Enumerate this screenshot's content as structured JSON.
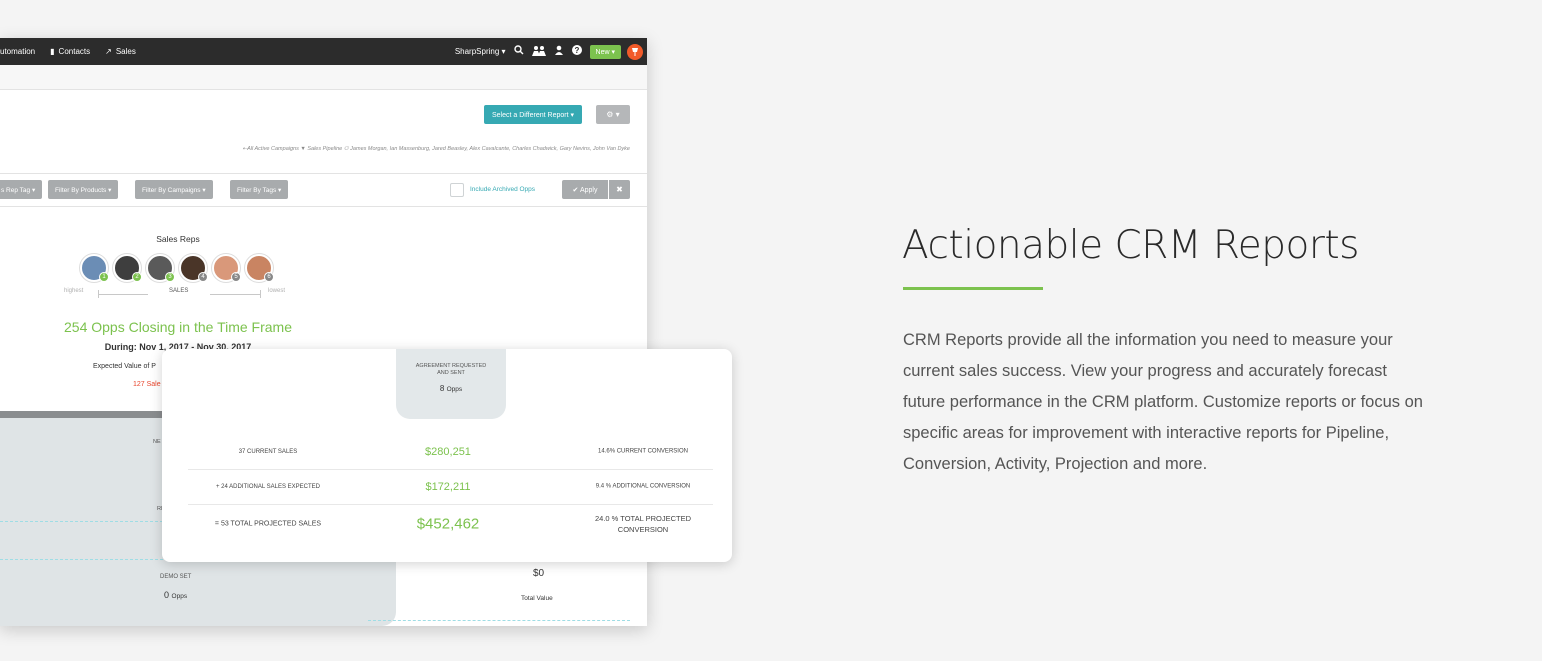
{
  "topbar": {
    "nav": [
      {
        "icon": "automation-icon",
        "glyph": "",
        "label": "utomation"
      },
      {
        "icon": "contacts-icon",
        "glyph": "▮",
        "label": "Contacts"
      },
      {
        "icon": "sales-icon",
        "glyph": "↗",
        "label": "Sales"
      }
    ],
    "brand": "SharpSpring ▾",
    "new_label": "New ▾",
    "icons": [
      "search-icon",
      "bell-icon",
      "user-icon",
      "help-icon",
      "notification-icon"
    ]
  },
  "header": {
    "report_button": "Select a Different Report ▾",
    "gear_button": "⚙ ▾",
    "crumbs": "⇠All Active Campaigns ▼ Sales Pipeline ⚇ James Morgan, Ian Massenburg, Jared Beasley, Alex Cavalcante, Charles Chadwick, Gary Nevins, John Van Dyke"
  },
  "filters": {
    "buttons": [
      "s Rep Tag ▾",
      "Filter By Products ▾",
      "Filter By Campaigns ▾",
      "Filter By Tags ▾"
    ],
    "archived_label": "Include Archived Opps",
    "apply_label": "✔ Apply",
    "clear_label": "✖"
  },
  "reps": {
    "title": "Sales Reps",
    "avatars": [
      {
        "rank": "1",
        "color": "#6b8db5"
      },
      {
        "rank": "2",
        "color": "#3e3e3e"
      },
      {
        "rank": "3",
        "color": "#5a5a5a"
      },
      {
        "rank": "4",
        "color": "#4a3528"
      },
      {
        "rank": "5",
        "color": "#d9987a"
      },
      {
        "rank": "6",
        "color": "#c98462"
      }
    ],
    "scale_high": "highest",
    "scale_mid": "SALES",
    "scale_low": "lowest"
  },
  "summary": {
    "opps_heading": "254 Opps Closing in the Time Frame",
    "during": "During: Nov 1, 2017 - Nov 30, 2017",
    "expected": "Expected Value of P",
    "sales_red": "127 Sale"
  },
  "funnel": {
    "label_ne": "NE",
    "label_ri": "RI",
    "demo_label": "DEMO SET",
    "demo_count": "0",
    "demo_unit": "Opps",
    "zero_value": "$0",
    "total_label": "Total Value"
  },
  "card": {
    "agreement_label_1": "AGREEMENT REQUESTED",
    "agreement_label_2": "AND SENT",
    "agreement_count": "8",
    "agreement_unit": "Opps",
    "rows": [
      {
        "label": "37 CURRENT SALES",
        "value": "$280,251",
        "conversion": "14.6% CURRENT CONVERSION"
      },
      {
        "label": "+ 24 ADDITIONAL SALES EXPECTED",
        "value": "$172,211",
        "conversion": "9.4 % ADDITIONAL CONVERSION"
      },
      {
        "label": "= 53 TOTAL PROJECTED SALES",
        "value": "$452,462",
        "conversion": "24.0 % TOTAL PROJECTED CONVERSION"
      }
    ]
  },
  "marketing": {
    "heading": "Actionable CRM Reports",
    "description": "CRM Reports provide all the information you need to measure your current sales success. View your progress and accurately forecast future performance in the CRM platform. Customize reports or focus on specific areas for improvement with interactive reports for Pipeline, Conversion, Activity, Projection and more."
  },
  "colors": {
    "accent_green": "#7cc24e",
    "teal": "#36a9b3",
    "topbar": "#2c2c2c",
    "alert_red": "#e8452c"
  }
}
